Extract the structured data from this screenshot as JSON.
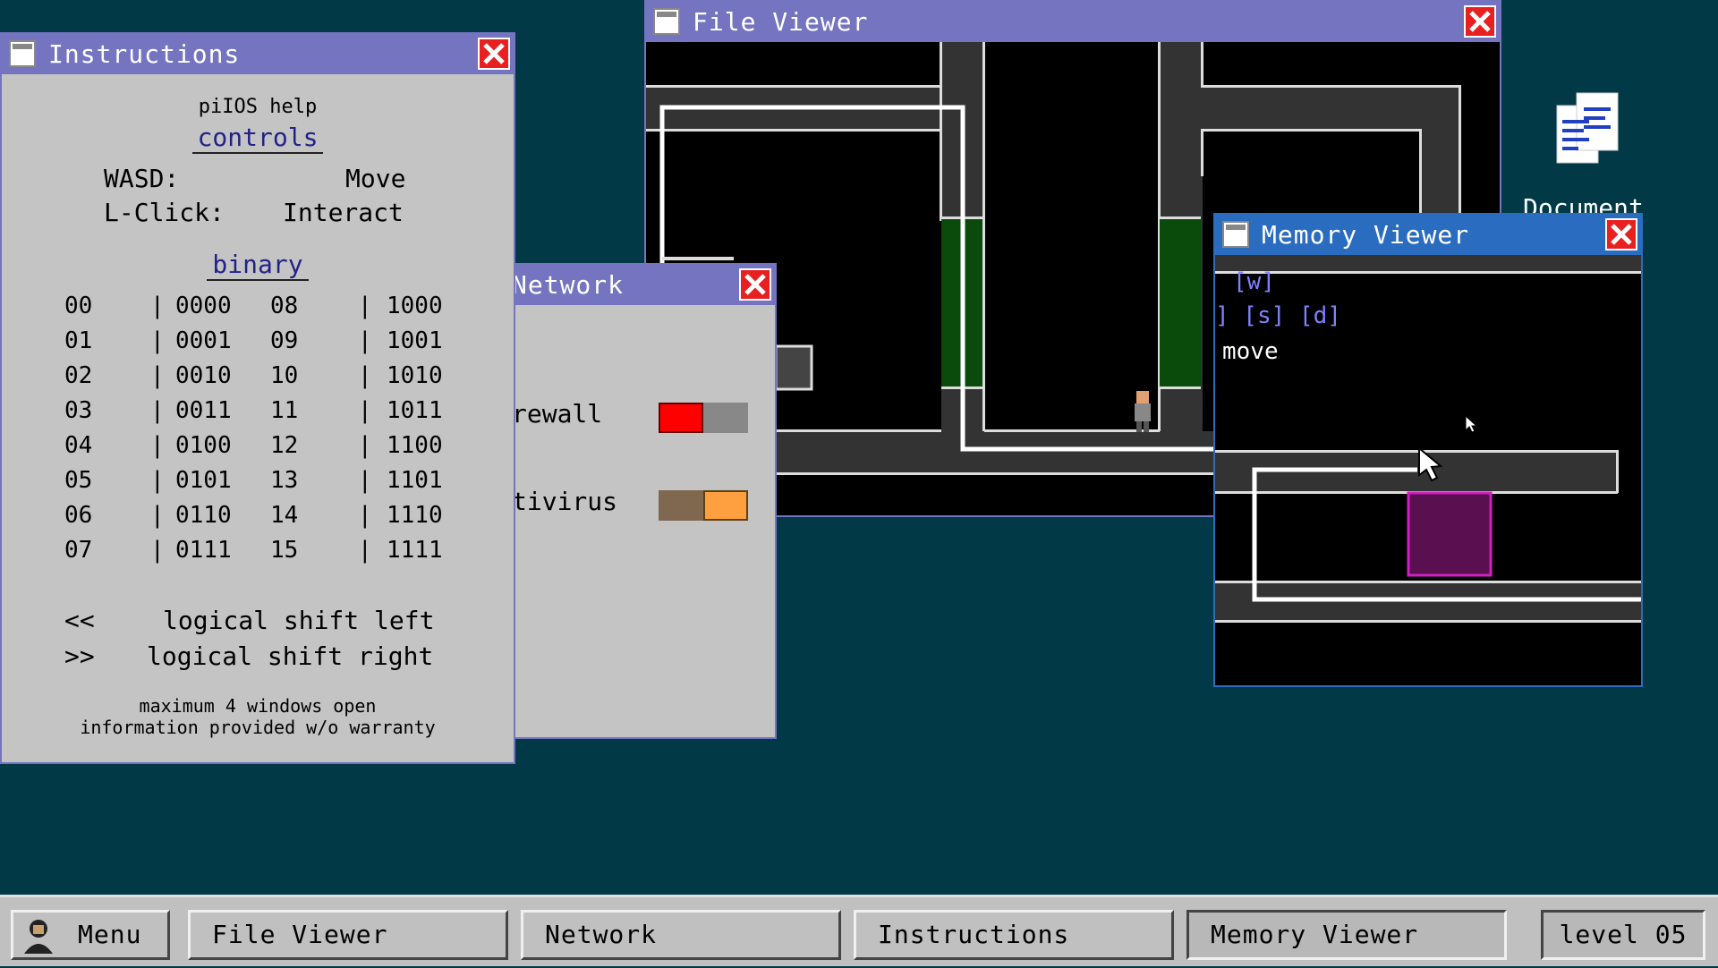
{
  "windows": {
    "instructions": {
      "title": "Instructions",
      "heading": "piIOS help",
      "controls_link": "controls",
      "controls": [
        {
          "key": "WASD:",
          "action": "Move"
        },
        {
          "key": "L-Click:",
          "action": "Interact"
        }
      ],
      "binary_link": "binary",
      "binary": [
        [
          "00",
          "|",
          "0000",
          "08",
          "|",
          "1000"
        ],
        [
          "01",
          "|",
          "0001",
          "09",
          "|",
          "1001"
        ],
        [
          "02",
          "|",
          "0010",
          "10",
          "|",
          "1010"
        ],
        [
          "03",
          "|",
          "0011",
          "11",
          "|",
          "1011"
        ],
        [
          "04",
          "|",
          "0100",
          "12",
          "|",
          "1100"
        ],
        [
          "05",
          "|",
          "0101",
          "13",
          "|",
          "1101"
        ],
        [
          "06",
          "|",
          "0110",
          "14",
          "|",
          "1110"
        ],
        [
          "07",
          "|",
          "0111",
          "15",
          "|",
          "1111"
        ]
      ],
      "shift_left_sym": "<<",
      "shift_left_label": "logical shift left",
      "shift_right_sym": ">>",
      "shift_right_label": "logical shift right",
      "footer_line1": "maximum 4 windows open",
      "footer_line2": "information provided w/o warranty"
    },
    "network": {
      "title": "Network",
      "firewall_label": "rewall",
      "antivirus_label": "tivirus",
      "colors": {
        "firewall_on": "#ff0000",
        "firewall_off": "#888888",
        "antivirus_on": "#ffa040",
        "antivirus_off": "#806850"
      }
    },
    "file_viewer": {
      "title": "File Viewer"
    },
    "memory_viewer": {
      "title": "Memory Viewer",
      "hint_w": "[w]",
      "hint_sd": "] [s] [d]",
      "hint_move": "move"
    }
  },
  "desktop": {
    "icon_label": "Document",
    "icon_name": "document-icon"
  },
  "taskbar": {
    "menu": "Menu",
    "items": [
      "File Viewer",
      "Network",
      "Instructions",
      "Memory Viewer"
    ],
    "level": "level 05"
  }
}
